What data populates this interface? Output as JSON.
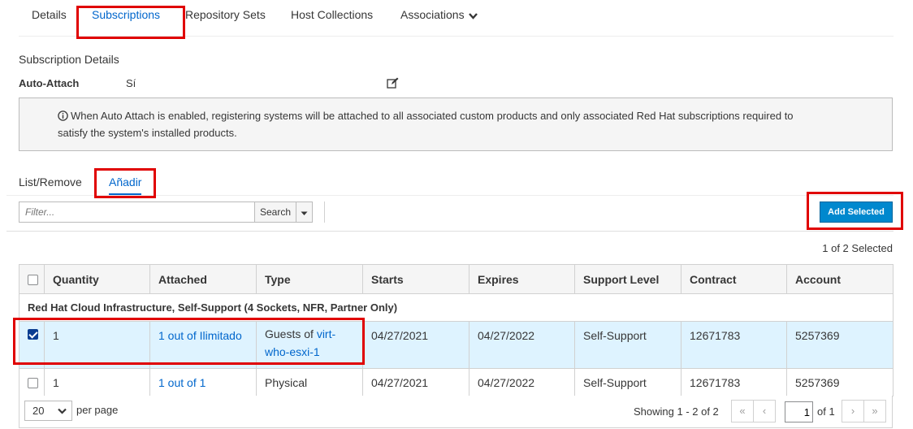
{
  "tabs": [
    {
      "label": "Details"
    },
    {
      "label": "Subscriptions"
    },
    {
      "label": "Repository Sets"
    },
    {
      "label": "Host Collections"
    },
    {
      "label": "Associations"
    }
  ],
  "details": {
    "title": "Subscription Details",
    "auto_attach_label": "Auto-Attach",
    "auto_attach_value": "Sí",
    "info_line1": "When Auto Attach is enabled, registering systems will be attached to all associated custom products and only associated Red Hat subscriptions required to",
    "info_line2": "satisfy the system's installed products."
  },
  "subtabs": [
    {
      "label": "List/Remove"
    },
    {
      "label": "Añadir"
    }
  ],
  "toolbar": {
    "filter_placeholder": "Filter...",
    "search_label": "Search",
    "add_selected_label": "Add Selected",
    "selected_count": "1 of 2 Selected"
  },
  "table": {
    "columns": [
      "Quantity",
      "Attached",
      "Type",
      "Starts",
      "Expires",
      "Support Level",
      "Contract",
      "Account"
    ],
    "group": "Red Hat Cloud Infrastructure, Self-Support (4 Sockets, NFR, Partner Only)",
    "rows": [
      {
        "checked": true,
        "quantity": "1",
        "attached": "1 out of Ilimitado",
        "type_prefix": "Guests of",
        "type_link_1": "virt-",
        "type_link_2": "who-esxi-1",
        "starts": "04/27/2021",
        "expires": "04/27/2022",
        "support": "Self-Support",
        "contract": "12671783",
        "account": "5257369"
      },
      {
        "checked": false,
        "quantity": "1",
        "attached": "1 out of 1",
        "type": "Physical",
        "starts": "04/27/2021",
        "expires": "04/27/2022",
        "support": "Self-Support",
        "contract": "12671783",
        "account": "5257369"
      }
    ]
  },
  "pagination": {
    "per_page_value": "20",
    "per_page_label": "per page",
    "showing": "Showing 1 - 2 of 2",
    "page_value": "1",
    "of_label": "of 1"
  }
}
